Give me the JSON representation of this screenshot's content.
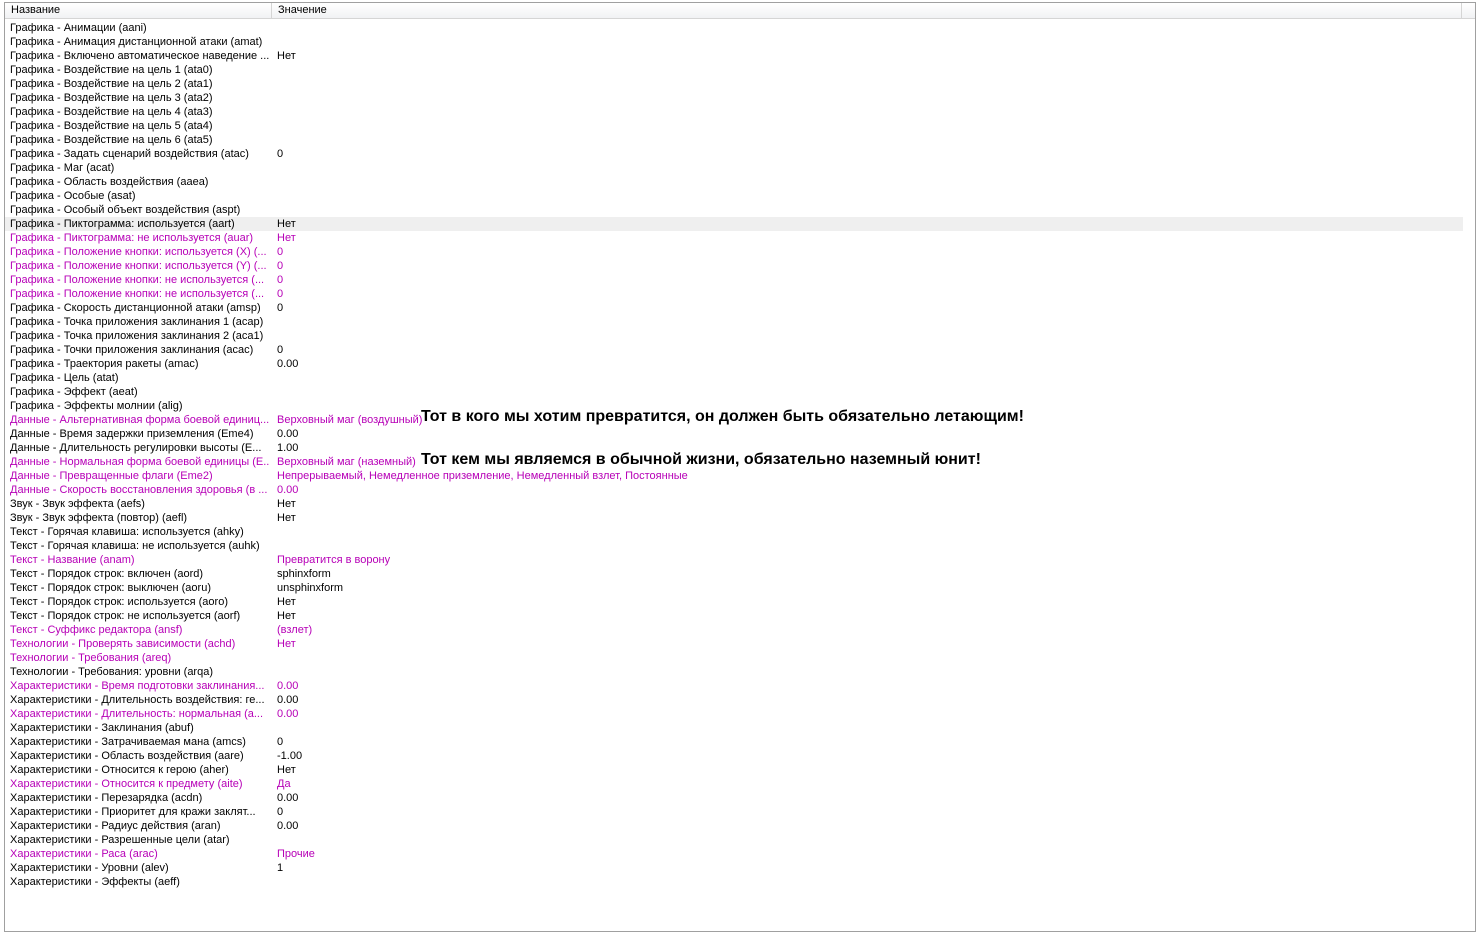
{
  "columns": {
    "name": "Название",
    "value": "Значение"
  },
  "rows": [
    {
      "name": "Графика - Анимации (aani)",
      "value": "",
      "modified": false
    },
    {
      "name": "Графика - Анимация дистанционной атаки (amat)",
      "value": "",
      "modified": false
    },
    {
      "name": "Графика - Включено автоматическое наведение ...",
      "value": "Нет",
      "modified": false
    },
    {
      "name": "Графика - Воздействие на цель 1 (ata0)",
      "value": "",
      "modified": false
    },
    {
      "name": "Графика - Воздействие на цель 2 (ata1)",
      "value": "",
      "modified": false
    },
    {
      "name": "Графика - Воздействие на цель 3 (ata2)",
      "value": "",
      "modified": false
    },
    {
      "name": "Графика - Воздействие на цель 4 (ata3)",
      "value": "",
      "modified": false
    },
    {
      "name": "Графика - Воздействие на цель 5 (ata4)",
      "value": "",
      "modified": false
    },
    {
      "name": "Графика - Воздействие на цель 6 (ata5)",
      "value": "",
      "modified": false
    },
    {
      "name": "Графика - Задать сценарий воздействия (atac)",
      "value": "0",
      "modified": false
    },
    {
      "name": "Графика - Маг (acat)",
      "value": "",
      "modified": false
    },
    {
      "name": "Графика - Область воздействия (aaea)",
      "value": "",
      "modified": false
    },
    {
      "name": "Графика - Особые (asat)",
      "value": "",
      "modified": false
    },
    {
      "name": "Графика - Особый объект воздействия (aspt)",
      "value": "",
      "modified": false
    },
    {
      "name": "Графика - Пиктограмма: используется (aart)",
      "value": "Нет",
      "modified": false,
      "selected": true
    },
    {
      "name": "Графика - Пиктограмма: не используется (auar)",
      "value": "Нет",
      "modified": true
    },
    {
      "name": "Графика - Положение кнопки: используется (X) (...",
      "value": "0",
      "modified": true
    },
    {
      "name": "Графика - Положение кнопки: используется (Y) (...",
      "value": "0",
      "modified": true
    },
    {
      "name": "Графика - Положение кнопки: не используется (...",
      "value": "0",
      "modified": true
    },
    {
      "name": "Графика - Положение кнопки: не используется (...",
      "value": "0",
      "modified": true
    },
    {
      "name": "Графика - Скорость дистанционной атаки (amsp)",
      "value": "0",
      "modified": false
    },
    {
      "name": "Графика - Точка приложения заклинания 1 (acap)",
      "value": "",
      "modified": false
    },
    {
      "name": "Графика - Точка приложения заклинания 2 (aca1)",
      "value": "",
      "modified": false
    },
    {
      "name": "Графика - Точки приложения заклинания (acac)",
      "value": "0",
      "modified": false
    },
    {
      "name": "Графика - Траектория ракеты (amac)",
      "value": "0.00",
      "modified": false
    },
    {
      "name": "Графика - Цель (atat)",
      "value": "",
      "modified": false
    },
    {
      "name": "Графика - Эффект (aeat)",
      "value": "",
      "modified": false
    },
    {
      "name": "Графика - Эффекты молнии (alig)",
      "value": "",
      "modified": false
    },
    {
      "name": "Данные - Альтернативная форма боевой единиц...",
      "value": "Верховный маг (воздушный)",
      "modified": true
    },
    {
      "name": "Данные - Время задержки приземления (Eme4)",
      "value": "0.00",
      "modified": false
    },
    {
      "name": "Данные - Длительность регулировки высоты (E...",
      "value": "1.00",
      "modified": false
    },
    {
      "name": "Данные - Нормальная форма боевой единицы (E...",
      "value": "Верховный маг (наземный)",
      "modified": true
    },
    {
      "name": "Данные - Превращенные флаги (Eme2)",
      "value": "Непрерываемый, Немедленное приземление, Немедленный взлет, Постоянные",
      "modified": true
    },
    {
      "name": "Данные - Скорость восстановления здоровья (в ...",
      "value": "0.00",
      "modified": true
    },
    {
      "name": "Звук - Звук эффекта (aefs)",
      "value": "Нет",
      "modified": false
    },
    {
      "name": "Звук - Звук эффекта (повтор) (aefl)",
      "value": "Нет",
      "modified": false
    },
    {
      "name": "Текст - Горячая клавиша: используется (ahky)",
      "value": "",
      "modified": false
    },
    {
      "name": "Текст - Горячая клавиша: не используется (auhk)",
      "value": "",
      "modified": false
    },
    {
      "name": "Текст - Название (anam)",
      "value": "Превратится в ворону",
      "modified": true
    },
    {
      "name": "Текст - Порядок строк: включен (aord)",
      "value": "sphinxform",
      "modified": false
    },
    {
      "name": "Текст - Порядок строк: выключен (aoru)",
      "value": "unsphinxform",
      "modified": false
    },
    {
      "name": "Текст - Порядок строк: используется (aoro)",
      "value": "Нет",
      "modified": false
    },
    {
      "name": "Текст - Порядок строк: не используется (aorf)",
      "value": "Нет",
      "modified": false
    },
    {
      "name": "Текст - Суффикс редактора (ansf)",
      "value": " (взлет)",
      "modified": true
    },
    {
      "name": "Технологии - Проверять зависимости (achd)",
      "value": "Нет",
      "modified": true
    },
    {
      "name": "Технологии - Требования (areq)",
      "value": "",
      "modified": true
    },
    {
      "name": "Технологии - Требования: уровни (arqa)",
      "value": "",
      "modified": false
    },
    {
      "name": "Характеристики - Время подготовки заклинания...",
      "value": "0.00",
      "modified": true
    },
    {
      "name": "Характеристики - Длительность воздействия: ге...",
      "value": "0.00",
      "modified": false
    },
    {
      "name": "Характеристики - Длительность: нормальная (a...",
      "value": "0.00",
      "modified": true
    },
    {
      "name": "Характеристики - Заклинания (abuf)",
      "value": "",
      "modified": false
    },
    {
      "name": "Характеристики - Затрачиваемая мана (amcs)",
      "value": "0",
      "modified": false
    },
    {
      "name": "Характеристики - Область воздействия (aare)",
      "value": "-1.00",
      "modified": false
    },
    {
      "name": "Характеристики - Относится к герою (aher)",
      "value": "Нет",
      "modified": false
    },
    {
      "name": "Характеристики - Относится к предмету (aite)",
      "value": "Да",
      "modified": true
    },
    {
      "name": "Характеристики - Перезарядка (acdn)",
      "value": "0.00",
      "modified": false
    },
    {
      "name": "Характеристики - Приоритет для кражи заклят...",
      "value": "0",
      "modified": false
    },
    {
      "name": "Характеристики - Радиус действия (aran)",
      "value": "0.00",
      "modified": false
    },
    {
      "name": "Характеристики - Разрешенные цели (atar)",
      "value": "",
      "modified": false
    },
    {
      "name": "Характеристики - Раса (arac)",
      "value": "Прочие",
      "modified": true
    },
    {
      "name": "Характеристики - Уровни (alev)",
      "value": "1",
      "modified": false
    },
    {
      "name": "Характеристики - Эффекты (aeff)",
      "value": "",
      "modified": false
    }
  ],
  "annotations": {
    "alt_form": "Тот в кого мы хотим превратится, он должен быть обязательно летающим!",
    "normal_form": "Тот кем мы являемся в обычной жизни, обязательно наземный юнит!"
  },
  "colors": {
    "modified": "#b700b7",
    "selected_row": "#efefef"
  }
}
